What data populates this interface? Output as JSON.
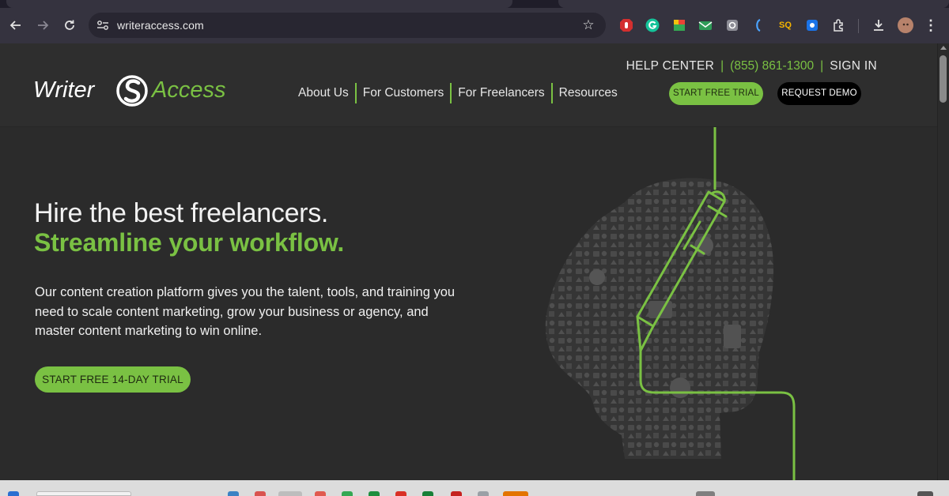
{
  "browser": {
    "url": "writeraccess.com",
    "extensions": [
      "adblock-icon",
      "grammarly-icon",
      "notes-icon",
      "mail-icon",
      "camera-icon",
      "bracket-icon",
      "seo-icon",
      "translate-icon",
      "puzzle-icon"
    ],
    "seo_label": "SQ"
  },
  "header": {
    "logo_left": "Writer",
    "logo_right": "Access",
    "nav": [
      "About Us",
      "For Customers",
      "For Freelancers",
      "Resources"
    ],
    "help_center": "HELP CENTER",
    "phone": "(855) 861-1300",
    "sign_in": "SIGN IN",
    "trial_button": "START FREE TRIAL",
    "demo_button": "REQUEST DEMO"
  },
  "hero": {
    "headline": "Hire the best freelancers.",
    "subheadline": "Streamline your workflow.",
    "lead": "Our content creation platform gives you the talent, tools, and training you need to scale content marketing, grow your business or agency, and master content marketing to win online.",
    "cta": "START FREE 14-DAY TRIAL"
  },
  "colors": {
    "brand_green": "#7ac143",
    "background": "#2b2b2b",
    "header_bg": "#2e2e2e"
  }
}
